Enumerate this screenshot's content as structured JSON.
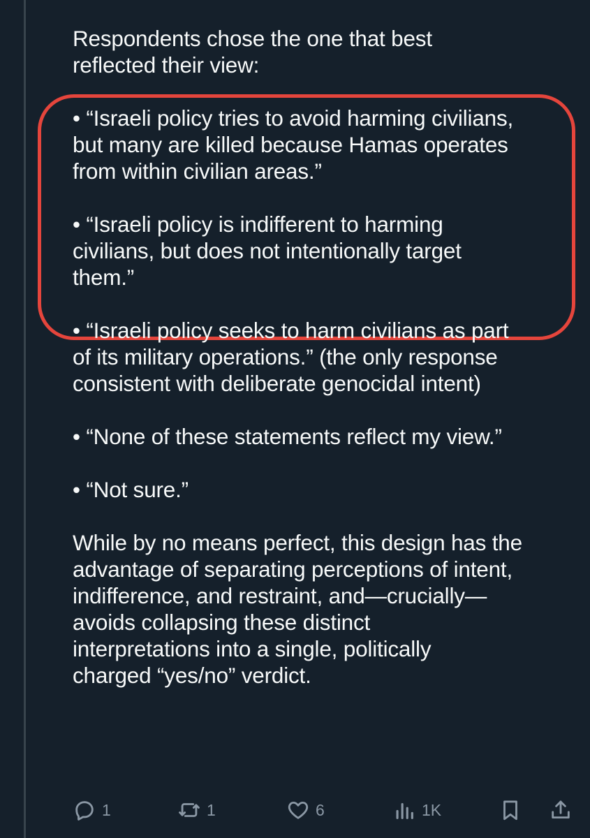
{
  "post": {
    "intro": "Respondents chose the one that best\nreflected their view:",
    "options": [
      "• “Israeli policy tries to avoid harming civilians,\nbut many are killed because Hamas operates\nfrom within civilian areas.”",
      "• “Israeli policy is indifferent to harming\ncivilians, but does not intentionally target\nthem.”",
      "• “Israeli policy seeks to harm civilians as part\nof its military operations.” (the only response\nconsistent with deliberate genocidal intent)",
      "• “None of these statements reflect my view.”",
      "• “Not sure.”"
    ],
    "conclusion": "While by no means perfect, this design has the\nadvantage of separating perceptions of intent,\nindifference, and restraint, and—crucially—\navoids collapsing these distinct\ninterpretations into a single, politically\ncharged “yes/no” verdict."
  },
  "annotation": {
    "highlight_color": "#e5453c"
  },
  "actions": {
    "reply": {
      "icon": "reply-icon",
      "count": "1"
    },
    "repost": {
      "icon": "repost-icon",
      "count": "1"
    },
    "like": {
      "icon": "heart-icon",
      "count": "6"
    },
    "views": {
      "icon": "views-icon",
      "count": "1K"
    },
    "bookmark": {
      "icon": "bookmark-icon"
    },
    "share": {
      "icon": "share-icon"
    }
  },
  "colors": {
    "background": "#15202b",
    "text": "#f7f9f9",
    "muted": "#8b98a5",
    "thread_line": "#38444d"
  }
}
